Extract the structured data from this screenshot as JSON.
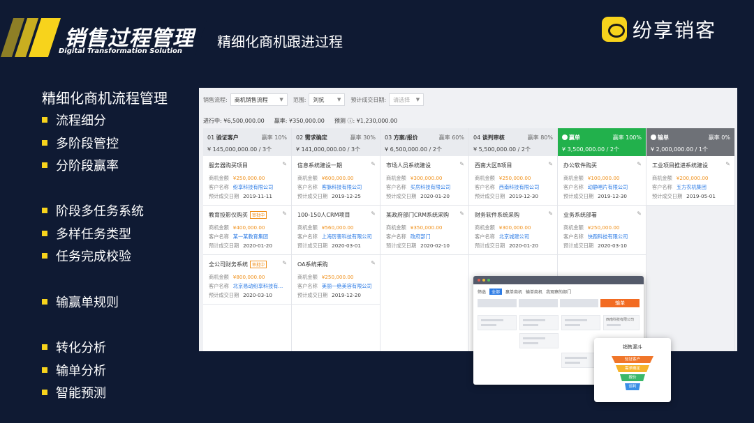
{
  "header": {
    "brand_title": "销售过程管理",
    "brand_subtitle": "Digital Transformation Solution",
    "page_subtitle": "精细化商机跟进过程",
    "logo_text": "纷享销客"
  },
  "left_panel": {
    "title": "精细化商机流程管理",
    "groups": [
      [
        "流程细分",
        "多阶段管控",
        "分阶段赢率"
      ],
      [
        "阶段多任务系统",
        "多样任务类型",
        "任务完成校验"
      ],
      [
        "输赢单规则"
      ],
      [
        "转化分析",
        "输单分析",
        "智能预测"
      ]
    ]
  },
  "crm": {
    "filters": {
      "process_label": "销售流程:",
      "process_value": "商机销售流程",
      "scope_label": "范围:",
      "scope_value": "刘抗",
      "date_label": "预计成交日期:",
      "date_placeholder": "请选择"
    },
    "stats": {
      "in_progress": "进行中: ¥6,500,000.00",
      "won": "赢率: ¥350,000.00",
      "forecast": "预测 ⓘ: ¥1,230,000.00"
    },
    "labels": {
      "amount": "商机金额",
      "customer": "客户名称",
      "date": "预计成交日期"
    },
    "columns": [
      {
        "no": "01",
        "stage": "验证客户",
        "rate": "赢率 10%",
        "summary": "¥ 145,000,000.00 / 3个",
        "cards": [
          {
            "name": "服务器购买项目",
            "tag": "",
            "amount": "¥250,000.00",
            "customer": "纷享科技有限公司",
            "date": "2019-11-11"
          },
          {
            "name": "教育投影仪购买",
            "tag": "审批中",
            "amount": "¥400,000.00",
            "customer": "某一某教育集团",
            "date": "2020-01-20"
          },
          {
            "name": "全公司财务系统",
            "tag": "审批中",
            "amount": "¥800,000.00",
            "customer": "北京易动纷享科技有...",
            "date": "2020-03-10"
          }
        ]
      },
      {
        "no": "02",
        "stage": "需求确定",
        "rate": "赢率 30%",
        "summary": "¥ 141,000,000.00 / 3个",
        "cards": [
          {
            "name": "信息系统建设一期",
            "tag": "",
            "amount": "¥600,000.00",
            "customer": "客脉科技有限公司",
            "date": "2019-12-25"
          },
          {
            "name": "100-150人CRM项目",
            "tag": "",
            "amount": "¥560,000.00",
            "customer": "上海厉害科技有限公司",
            "date": "2020-03-01"
          },
          {
            "name": "OA系统采购",
            "tag": "",
            "amount": "¥250,000.00",
            "customer": "美丽一绝美容有限公司",
            "date": "2019-12-20"
          }
        ]
      },
      {
        "no": "03",
        "stage": "方案/报价",
        "rate": "赢率 60%",
        "summary": "¥ 6,500,000.00 / 2个",
        "cards": [
          {
            "name": "市场人员系统建设",
            "tag": "",
            "amount": "¥300,000.00",
            "customer": "买房科技有限公司",
            "date": "2020-01-20"
          },
          {
            "name": "某政府部门CRM系统采购",
            "tag": "",
            "amount": "¥350,000.00",
            "customer": "政府部门",
            "date": "2020-02-10"
          }
        ]
      },
      {
        "no": "04",
        "stage": "谈判审核",
        "rate": "赢率 80%",
        "summary": "¥ 5,500,000.00 / 2个",
        "cards": [
          {
            "name": "西南大区B项目",
            "tag": "",
            "amount": "¥250,000.00",
            "customer": "西南科技有限公司",
            "date": "2019-12-30"
          },
          {
            "name": "财务软件系统采购",
            "tag": "",
            "amount": "¥300,000.00",
            "customer": "北京城建公司",
            "date": "2020-01-20"
          }
        ]
      },
      {
        "no": "",
        "stage": "赢单",
        "rate": "赢率 100%",
        "summary": "¥ 3,500,000.00 / 2个",
        "cards": [
          {
            "name": "办公软件购买",
            "tag": "",
            "amount": "¥100,000.00",
            "customer": "动静唱片有限公司",
            "date": "2019-12-30"
          },
          {
            "name": "业务系统部署",
            "tag": "",
            "amount": "¥250,000.00",
            "customer": "快跑科技有限公司",
            "date": "2020-03-10"
          }
        ]
      },
      {
        "no": "",
        "stage": "输单",
        "rate": "赢率 0%",
        "summary": "¥ 2,000,000.00 / 1个",
        "cards": [
          {
            "name": "工业项目推进系统建设",
            "tag": "",
            "amount": "¥200,000.00",
            "customer": "五方农机集团",
            "date": "2019-05-01"
          }
        ]
      }
    ]
  },
  "mini_window": {
    "tabs": [
      "筛选",
      "全部",
      "赢单商机",
      "输单商机",
      "我观察的部门"
    ],
    "lost_label": "输单",
    "card_text": "西南科技有限公司"
  },
  "funnel": {
    "title": "销售漏斗",
    "layers": [
      "验证客户",
      "需求确定",
      "报价",
      "谈判"
    ],
    "colors": [
      "#f0762a",
      "#f7b42c",
      "#3bb86a",
      "#3a8ee6"
    ]
  }
}
